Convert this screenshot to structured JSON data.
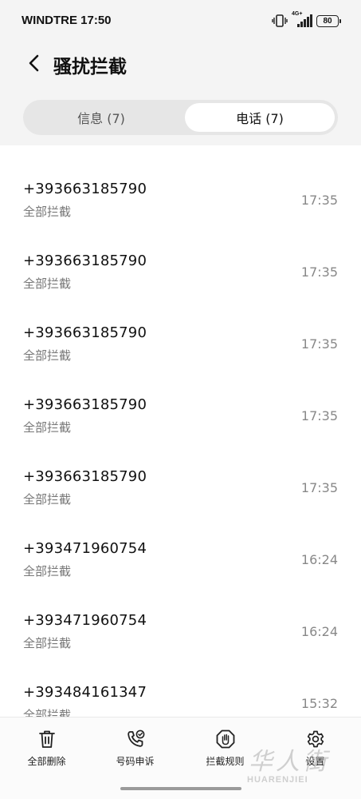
{
  "status_bar": {
    "carrier_time": "WINDTRE 17:50",
    "network_type": "4G+",
    "battery": "80",
    "icons": [
      "vibrate-icon",
      "signal-icon",
      "battery-icon"
    ]
  },
  "header": {
    "back_icon": "chevron-left-icon",
    "title": "骚扰拦截"
  },
  "tabs": [
    {
      "label": "信息 (7)",
      "selected": false
    },
    {
      "label": "电话 (7)",
      "selected": true
    }
  ],
  "calls": [
    {
      "number": "+393663185790",
      "status": "全部拦截",
      "time": "17:35"
    },
    {
      "number": "+393663185790",
      "status": "全部拦截",
      "time": "17:35"
    },
    {
      "number": "+393663185790",
      "status": "全部拦截",
      "time": "17:35"
    },
    {
      "number": "+393663185790",
      "status": "全部拦截",
      "time": "17:35"
    },
    {
      "number": "+393663185790",
      "status": "全部拦截",
      "time": "17:35"
    },
    {
      "number": "+393471960754",
      "status": "全部拦截",
      "time": "16:24"
    },
    {
      "number": "+393471960754",
      "status": "全部拦截",
      "time": "16:24"
    },
    {
      "number": "+393484161347",
      "status": "全部拦截",
      "time": "15:32"
    }
  ],
  "actions": [
    {
      "label": "全部删除",
      "icon": "trash-icon"
    },
    {
      "label": "号码申诉",
      "icon": "phone-appeal-icon"
    },
    {
      "label": "拦截规则",
      "icon": "hand-stop-icon"
    },
    {
      "label": "设置",
      "icon": "gear-icon"
    }
  ],
  "watermark": {
    "cn": "华人街",
    "en": "HUARENJIEI"
  },
  "colors": {
    "background": "#ffffff",
    "header_bg": "#f4f4f4",
    "tab_track": "#e6e6e6",
    "primary_text": "#111111",
    "secondary_text": "#777777"
  }
}
